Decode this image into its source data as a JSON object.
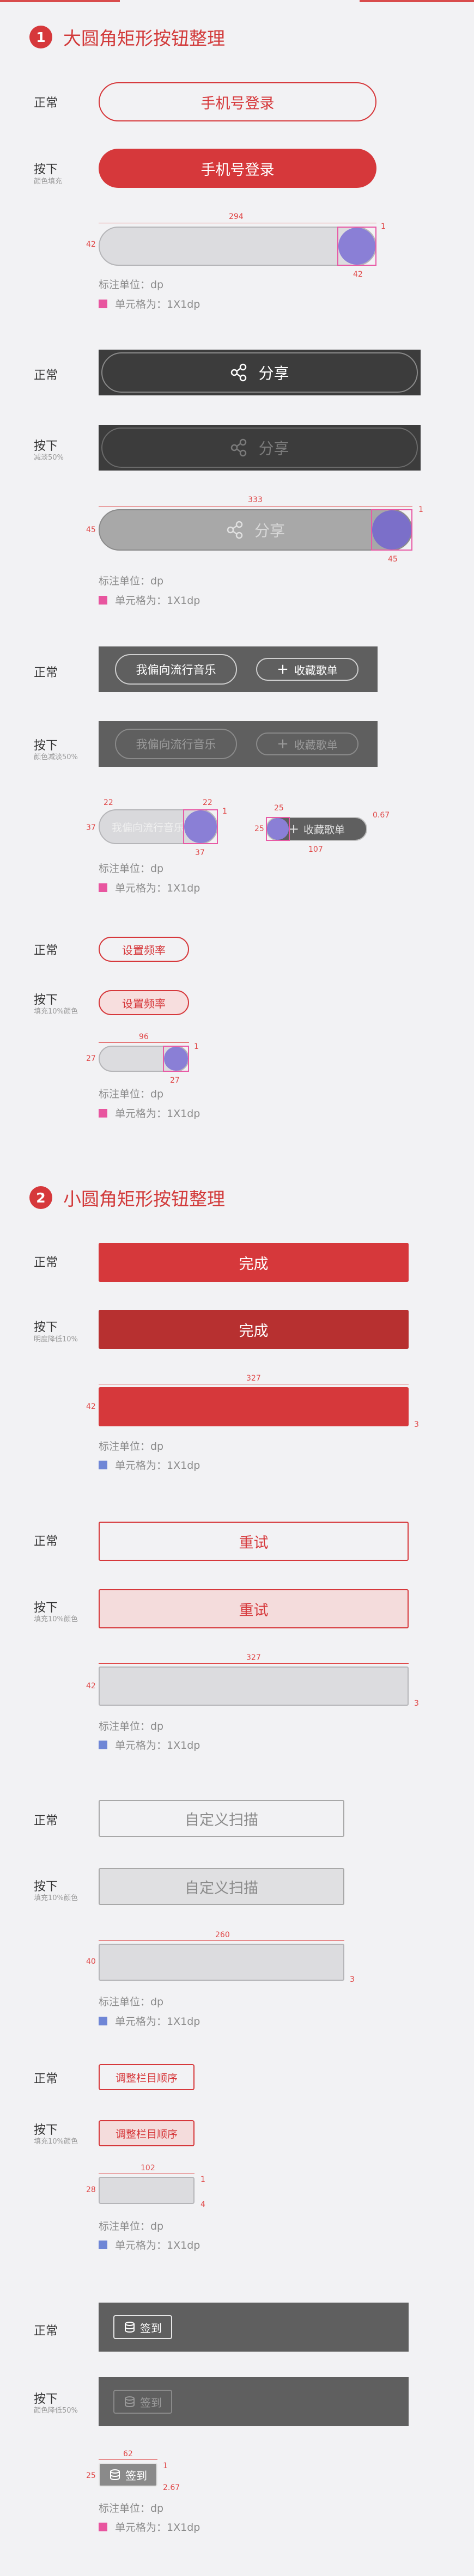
{
  "colors": {
    "accent": "#d6383b",
    "pink_swatch": "#e8559f",
    "blue_swatch": "#6f86d6",
    "dark_bar": "#3c3c3c",
    "gray_bar": "#5f5f5f"
  },
  "section1": {
    "number": "1",
    "title": "大圆角矩形按钮整理"
  },
  "section2": {
    "number": "2",
    "title": "小圆角矩形按钮整理"
  },
  "labels": {
    "normal": "正常",
    "pressed": "按下",
    "unit_note": "标注单位：dp",
    "unit_size": "单元格为：1X1dp"
  },
  "g1": {
    "label": "手机号登录",
    "pressed_sub": "颜色填充",
    "w": "294",
    "h": "42",
    "r": "1",
    "c": "42"
  },
  "g2": {
    "label": "分享",
    "pressed_sub": "减淡50%",
    "w": "333",
    "h": "45",
    "r": "1",
    "c": "45"
  },
  "g3": {
    "label_a": "我偏向流行音乐",
    "label_b": "收藏歌单",
    "plus": "+",
    "pressed_sub": "颜色减淡50%",
    "a_w1": "22",
    "a_w2": "22",
    "a_h": "37",
    "a_r": "1",
    "a_c": "37",
    "b_w": "25",
    "b_h": "25",
    "b_r": "0.67",
    "b_c": "107"
  },
  "g4": {
    "label": "设置频率",
    "pressed_sub": "填充10%颜色",
    "w": "96",
    "h": "27",
    "r": "1",
    "c": "27"
  },
  "g5": {
    "label": "完成",
    "pressed_sub": "明度降低10%",
    "w": "327",
    "h": "42",
    "r": "3"
  },
  "g6": {
    "label": "重试",
    "pressed_sub": "填充10%颜色",
    "w": "327",
    "h": "42",
    "r": "3"
  },
  "g7": {
    "label": "自定义扫描",
    "pressed_sub": "填充10%颜色",
    "w": "260",
    "h": "40",
    "r": "3"
  },
  "g8": {
    "label": "调整栏目顺序",
    "pressed_sub": "填充10%颜色",
    "w": "102",
    "h": "28",
    "r1": "1",
    "r2": "4"
  },
  "g9": {
    "label": "签到",
    "pressed_sub": "颜色降低50%",
    "w": "62",
    "h": "25",
    "r1": "1",
    "r2": "2.67"
  }
}
